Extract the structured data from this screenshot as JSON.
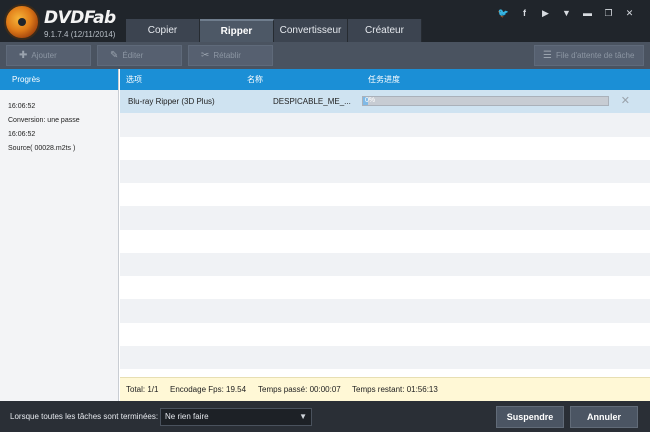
{
  "app": {
    "logo_text": "DVDFab",
    "version": "9.1.7.4 (12/11/2014)"
  },
  "tabs": [
    {
      "label": "Copier"
    },
    {
      "label": "Ripper"
    },
    {
      "label": "Convertisseur"
    },
    {
      "label": "Créateur"
    }
  ],
  "toolbar": {
    "add_label": "Ajouter",
    "edit_label": "Éditer",
    "refresh_label": "Rétablir",
    "queue_label": "File d'attente de tâche"
  },
  "left_panel": {
    "header": "Progrès",
    "log": [
      "16:06:52",
      "Conversion: une passe",
      "16:06:52",
      "Source( 00028.m2ts )"
    ]
  },
  "table": {
    "columns": [
      "选项",
      "名称",
      "任务进度"
    ],
    "rows": [
      {
        "option": "Blu-ray Ripper (3D Plus)",
        "name": "DESPICABLE_ME_...",
        "progress_percent": 0,
        "progress_label": "0%"
      }
    ]
  },
  "status": {
    "total": "Total: 1/1",
    "fps": "Encodage Fps: 19.54",
    "elapsed": "Temps passé: 00:00:07",
    "remaining": "Temps restant: 01:56:13"
  },
  "bottom": {
    "label": "Lorsque toutes les tâches sont terminées:",
    "select_value": "Ne rien faire",
    "suspend_label": "Suspendre",
    "cancel_label": "Annuler"
  }
}
